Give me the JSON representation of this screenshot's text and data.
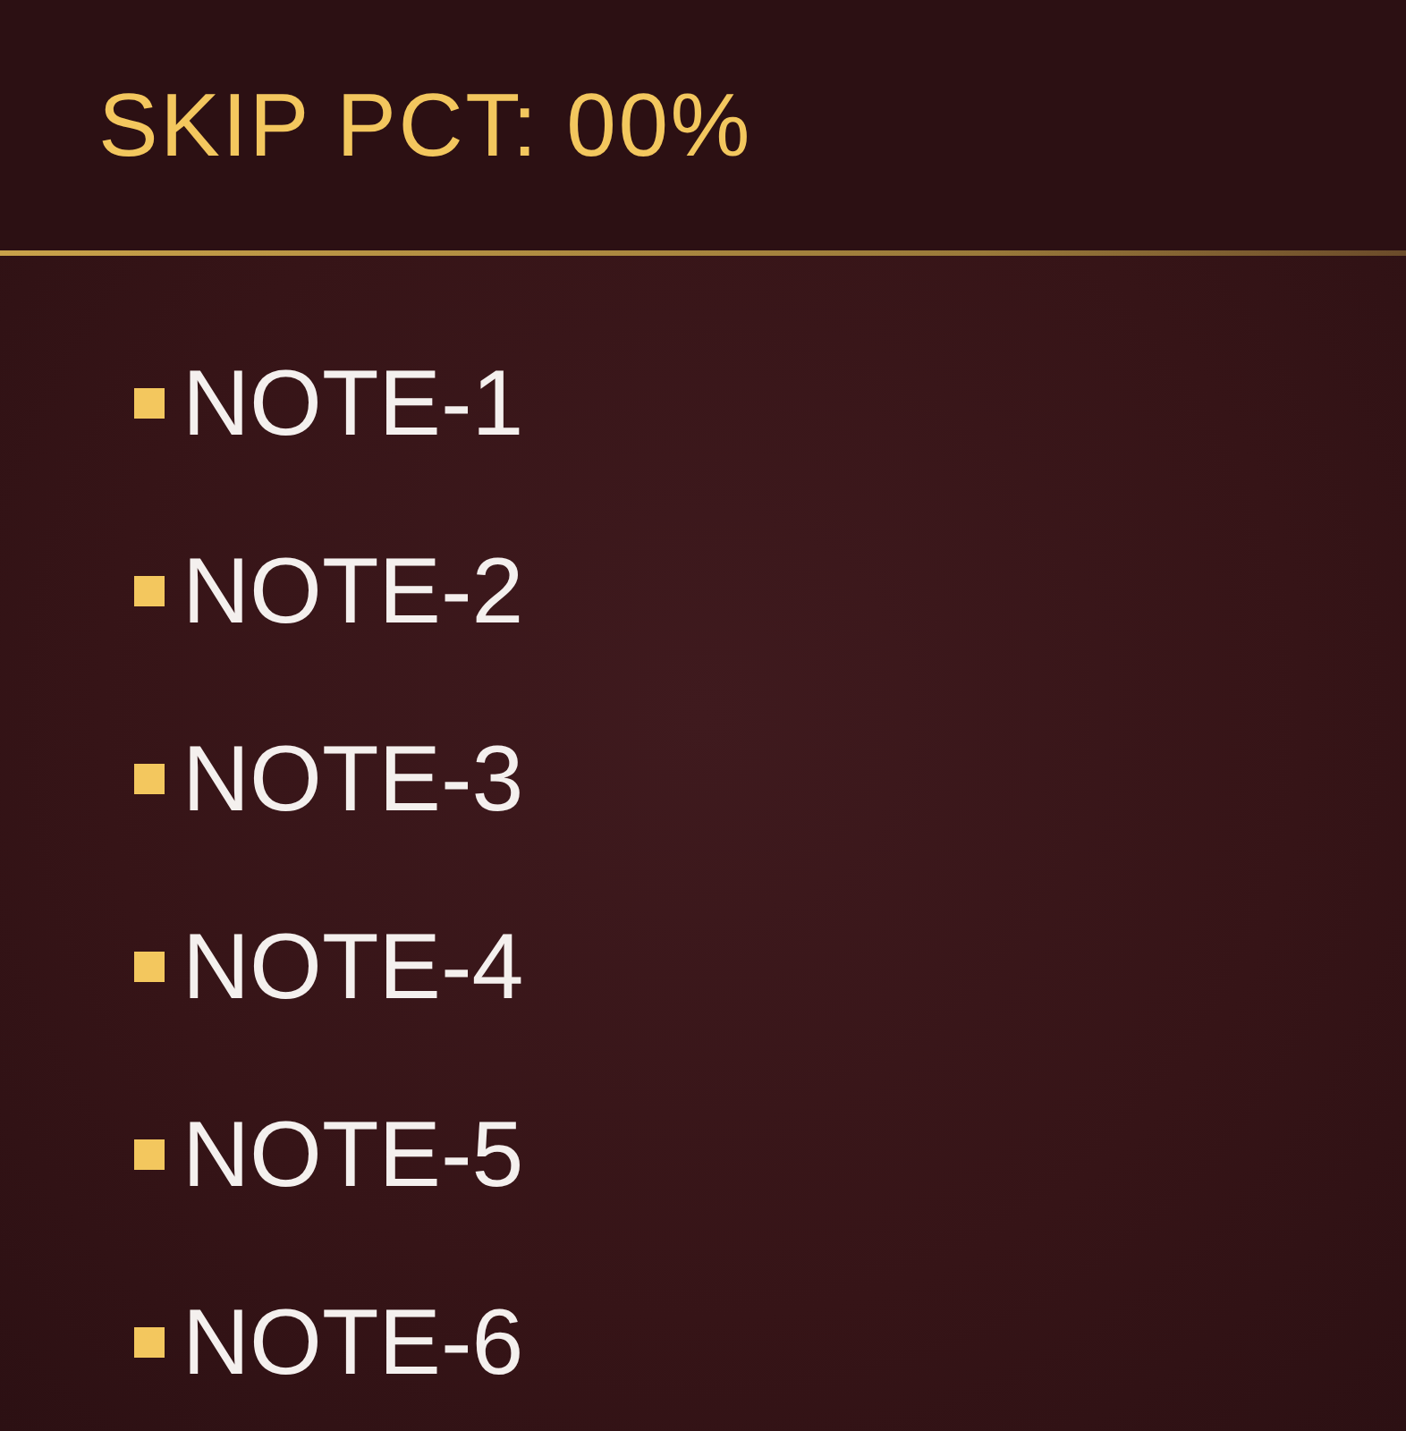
{
  "header": {
    "title": "SKIP PCT: 00%"
  },
  "notes": [
    {
      "label": "NOTE-1"
    },
    {
      "label": "NOTE-2"
    },
    {
      "label": "NOTE-3"
    },
    {
      "label": "NOTE-4"
    },
    {
      "label": "NOTE-5"
    },
    {
      "label": "NOTE-6"
    }
  ]
}
